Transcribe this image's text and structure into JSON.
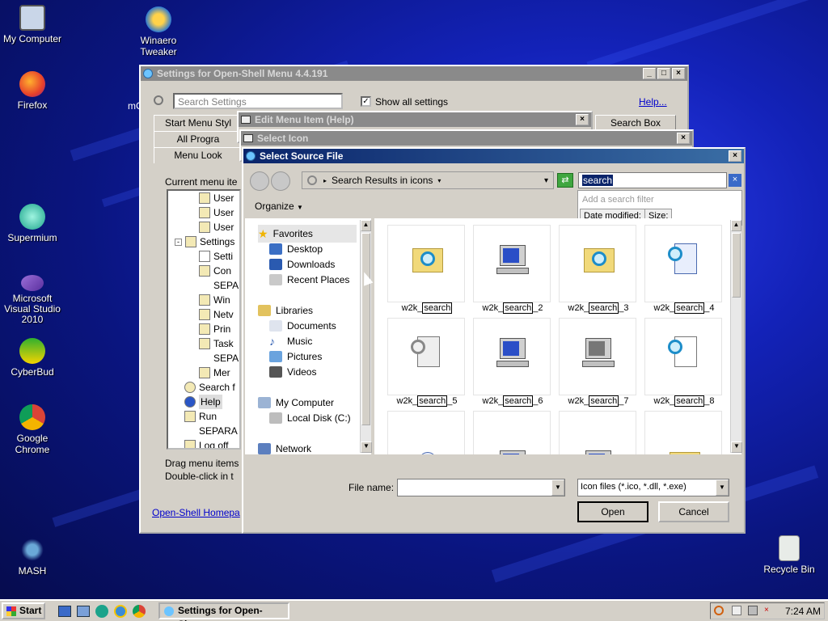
{
  "desktop": {
    "icons": [
      {
        "label": "My Computer",
        "icon": "my-computer-icon"
      },
      {
        "label": "Winaero Tweaker",
        "icon": "winaero-icon"
      },
      {
        "label": "Firefox",
        "icon": "firefox-icon"
      },
      {
        "label": "Supermium",
        "icon": "supermium-icon"
      },
      {
        "label": "Microsoft Visual Studio 2010",
        "icon": "visual-studio-icon"
      },
      {
        "label": "CyberBud",
        "icon": "cyberbud-icon"
      },
      {
        "label": "Google Chrome",
        "icon": "chrome-icon"
      },
      {
        "label": "MASH",
        "icon": "mash-icon"
      },
      {
        "label": "Recycle Bin",
        "icon": "recycle-bin-icon"
      }
    ],
    "partial_label": "mC"
  },
  "settings_window": {
    "title": "Settings for Open-Shell Menu 4.4.191",
    "search_placeholder": "Search Settings",
    "show_all_label": "Show all settings",
    "help_link": "Help...",
    "tabs": [
      "Start Menu Styl",
      "All Progra",
      "Menu Look",
      "Search Box"
    ],
    "current_menu_label": "Current menu ite",
    "tree": [
      "User",
      "User",
      "User",
      "Settings",
      "Setti",
      "Con",
      "SEPA",
      "Win",
      "Netv",
      "Prin",
      "Task",
      "SEPA",
      "Mer",
      "Search f",
      "Help",
      "Run",
      "SEPARA",
      "Log off"
    ],
    "hint1": "Drag menu items",
    "hint2": "Double-click in t",
    "homepage_link": "Open-Shell Homepa"
  },
  "edit_window": {
    "title": "Edit Menu Item (Help)"
  },
  "select_icon_window": {
    "title": "Select Icon"
  },
  "source_dialog": {
    "title": "Select Source File",
    "address": "Search Results in icons",
    "search_value": "search",
    "add_filter": "Add a search filter",
    "filter_date": "Date modified:",
    "filter_size": "Size:",
    "organize": "Organize",
    "nav": {
      "favorites": "Favorites",
      "desktop": "Desktop",
      "downloads": "Downloads",
      "recent": "Recent Places",
      "libraries": "Libraries",
      "documents": "Documents",
      "music": "Music",
      "pictures": "Pictures",
      "videos": "Videos",
      "computer": "My Computer",
      "local_disk": "Local Disk (C:)",
      "network": "Network"
    },
    "files": [
      {
        "pre": "w2k_",
        "hl": "search",
        "post": ""
      },
      {
        "pre": "w2k_",
        "hl": "search",
        "post": "_2"
      },
      {
        "pre": "w2k_",
        "hl": "search",
        "post": "_3"
      },
      {
        "pre": "w2k_",
        "hl": "search",
        "post": "_4"
      },
      {
        "pre": "w2k_",
        "hl": "search",
        "post": "_5"
      },
      {
        "pre": "w2k_",
        "hl": "search",
        "post": "_6"
      },
      {
        "pre": "w2k_",
        "hl": "search",
        "post": "_7"
      },
      {
        "pre": "w2k_",
        "hl": "search",
        "post": "_8"
      }
    ],
    "file_name_label": "File name:",
    "file_name_value": "",
    "file_type": "Icon files (*.ico, *.dll, *.exe)",
    "open": "Open",
    "cancel": "Cancel"
  },
  "taskbar": {
    "start": "Start",
    "task": "Settings for Open-She...",
    "time": "7:24 AM"
  }
}
